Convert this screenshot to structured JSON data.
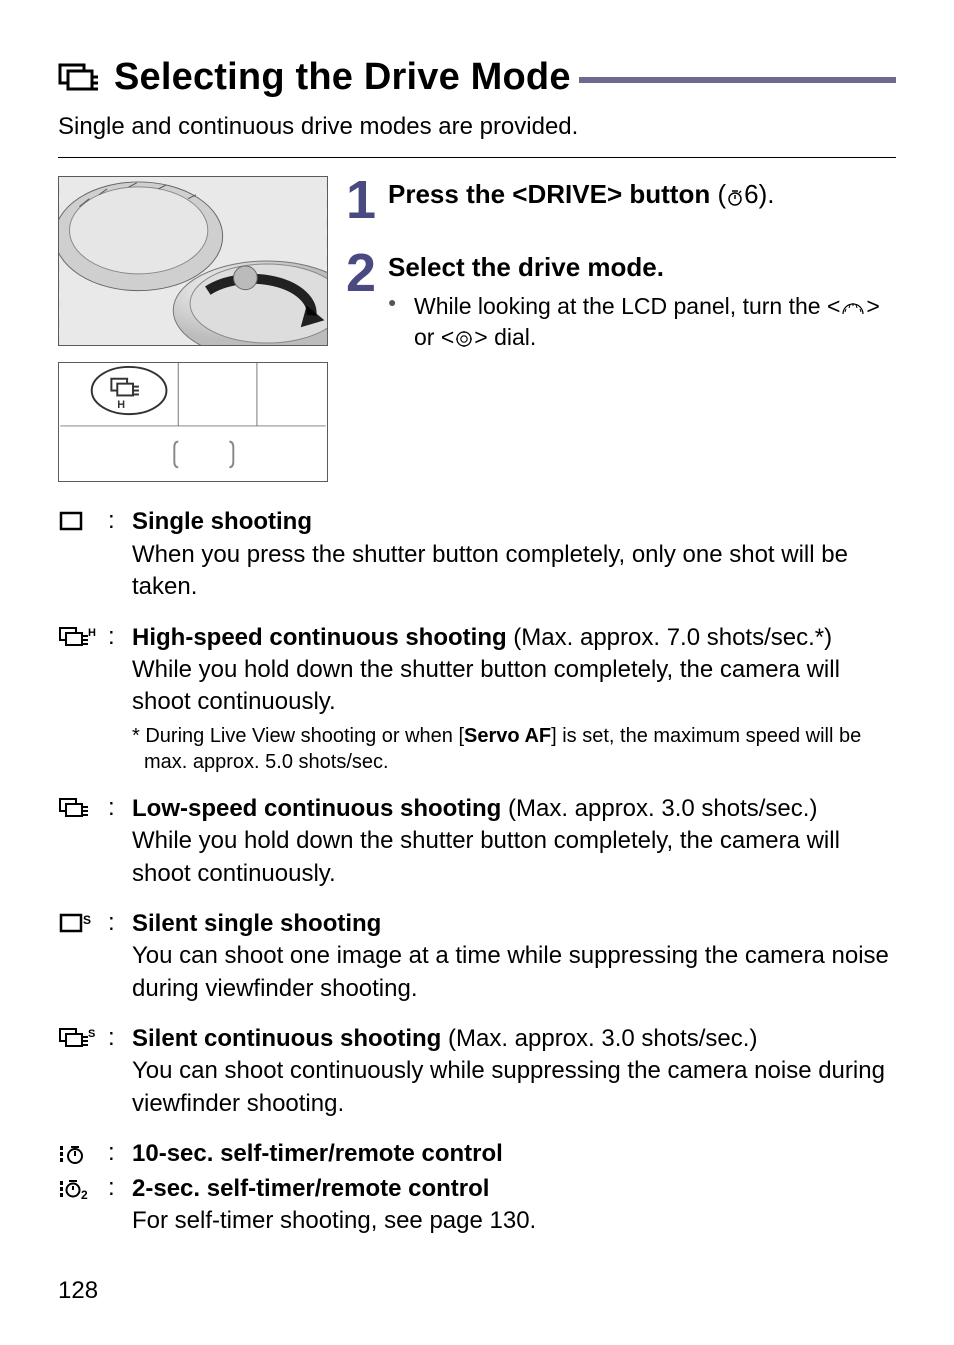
{
  "title": "Selecting the Drive Mode",
  "intro": "Single and continuous drive modes are provided.",
  "steps": [
    {
      "num": "1",
      "head_pre": "Press the <",
      "head_mid": "DRIVE",
      "head_post": "> button",
      "head_end": " (",
      "head_timer": "6",
      "head_closeparen": ").",
      "bullets": []
    },
    {
      "num": "2",
      "head": "Select the drive mode.",
      "bullet_pre": "While looking at the LCD panel, turn the <",
      "bullet_mid": "> or <",
      "bullet_post": "> dial."
    }
  ],
  "modes": {
    "single": {
      "label": "Single shooting",
      "desc": "When you press the shutter button completely, only one shot will be taken."
    },
    "high": {
      "label": "High-speed continuous shooting",
      "paren": " (Max. approx. 7.0 shots/sec.*)",
      "desc": "While you hold down the shutter button completely, the camera will shoot continuously.",
      "footnote_pre": "* During Live View shooting or when [",
      "footnote_bold": "Servo AF",
      "footnote_post": "] is set, the maximum speed will be max. approx. 5.0 shots/sec."
    },
    "low": {
      "label": "Low-speed continuous shooting",
      "paren": " (Max. approx. 3.0 shots/sec.)",
      "desc": "While you hold down the shutter button completely, the camera will shoot continuously."
    },
    "silent_single": {
      "label": "Silent single shooting",
      "desc": "You can shoot one image at a time while suppressing the camera noise during viewfinder shooting."
    },
    "silent_cont": {
      "label": "Silent continuous shooting",
      "paren": " (Max. approx. 3.0 shots/sec.)",
      "desc": "You can shoot continuously while suppressing the camera noise during viewfinder shooting."
    },
    "timer10": {
      "label": "10-sec. self-timer/remote control"
    },
    "timer2": {
      "label": "2-sec. self-timer/remote control",
      "desc": "For self-timer shooting, see page 130."
    }
  },
  "page_number": "128"
}
